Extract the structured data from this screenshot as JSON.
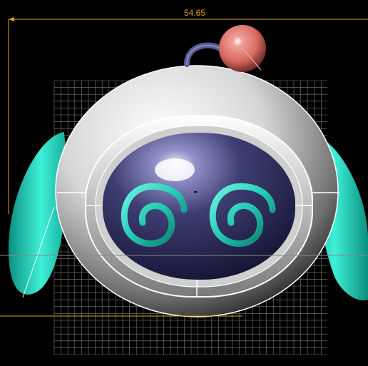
{
  "viewport": {
    "background": "#000000",
    "grid_color": "#8a8a8a",
    "dimension": {
      "value_label": "54.65",
      "color": "#e0a020"
    },
    "model": {
      "head_color": "#e8e8e8",
      "visor_color": "#2e2d5a",
      "ear_color": "#2ee0c8",
      "eye_color": "#2ad3c0",
      "antenna_ball_color": "#e07a72",
      "antenna_arc_color": "#4a4a7a"
    }
  }
}
